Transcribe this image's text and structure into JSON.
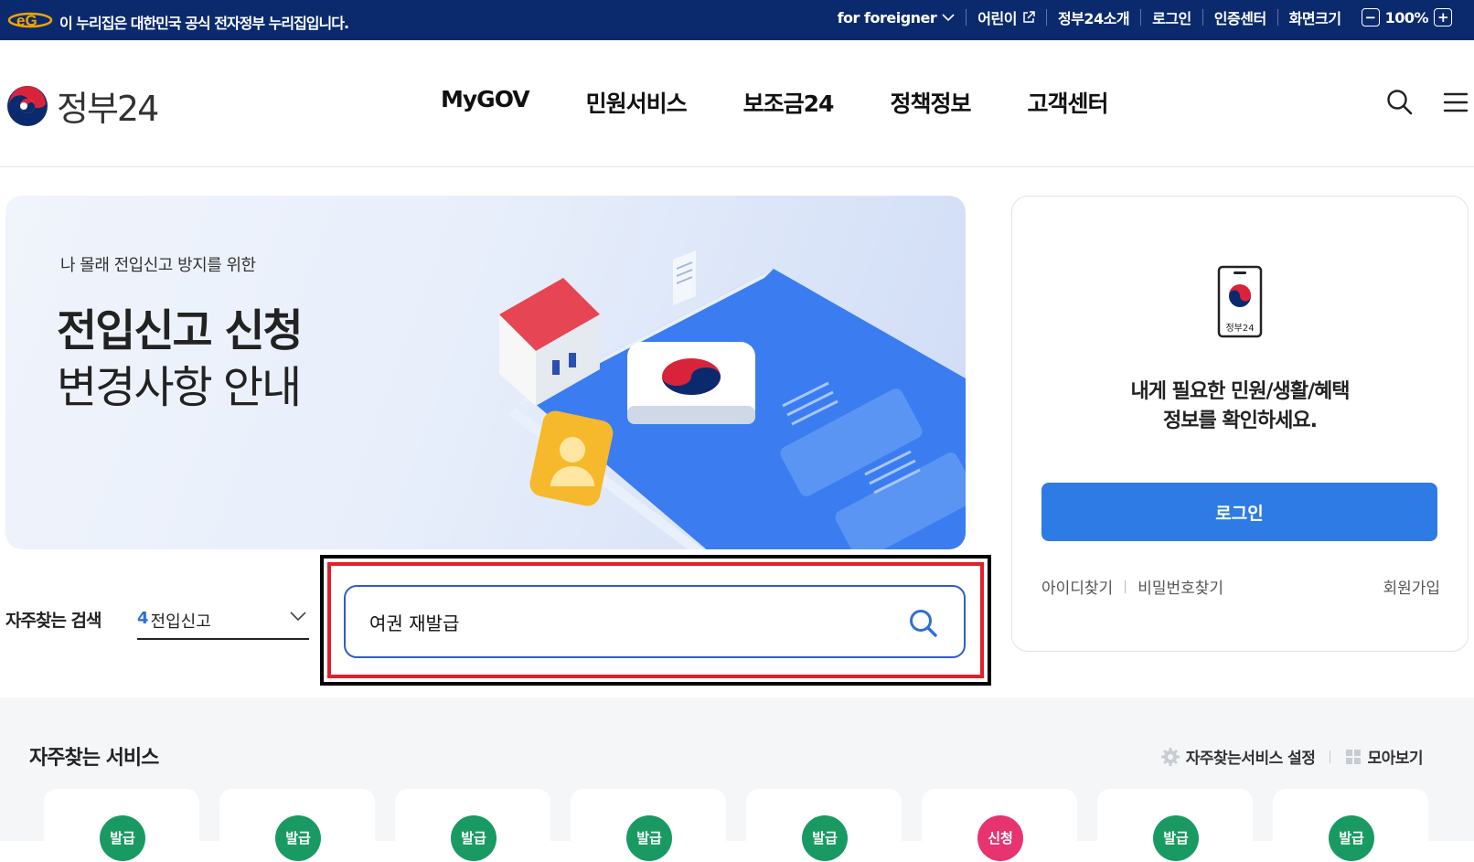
{
  "topbar": {
    "notice": "이 누리집은 대한민국 공식 전자정부 누리집입니다.",
    "links": [
      "for foreigner",
      "어린이",
      "정부24소개",
      "로그인",
      "인증센터",
      "화면크기"
    ],
    "zoom": "100%",
    "zoom_minus": "−",
    "zoom_plus": "+"
  },
  "header": {
    "logo_text": "정부24",
    "nav": [
      "MyGOV",
      "민원서비스",
      "보조금24",
      "정책정보",
      "고객센터"
    ]
  },
  "banner": {
    "subtitle": "나 몰래 전입신고 방지를 위한",
    "title_line1": "전입신고 신청",
    "title_line2": "변경사항 안내"
  },
  "login": {
    "phone_label": "정부24",
    "message_line1": "내게 필요한 민원/생활/혜택",
    "message_line2": "정보를 확인하세요.",
    "button": "로그인",
    "find_id": "아이디찾기",
    "find_pw": "비밀번호찾기",
    "join": "회원가입"
  },
  "frequent_search": {
    "label": "자주찾는 검색",
    "rank": "4",
    "term": "전입신고"
  },
  "search": {
    "value": "여권 재발급"
  },
  "services": {
    "title": "자주찾는 서비스",
    "settings": "자주찾는서비스 설정",
    "view_all": "모아보기",
    "cards": [
      {
        "badge": "발급",
        "color": "#1a9a63"
      },
      {
        "badge": "발급",
        "color": "#1a9a63"
      },
      {
        "badge": "발급",
        "color": "#1a9a63"
      },
      {
        "badge": "발급",
        "color": "#1a9a63"
      },
      {
        "badge": "발급",
        "color": "#1a9a63"
      },
      {
        "badge": "신청",
        "color": "#e7336f"
      },
      {
        "badge": "발급",
        "color": "#1a9a63"
      },
      {
        "badge": "발급",
        "color": "#1a9a63"
      }
    ]
  }
}
